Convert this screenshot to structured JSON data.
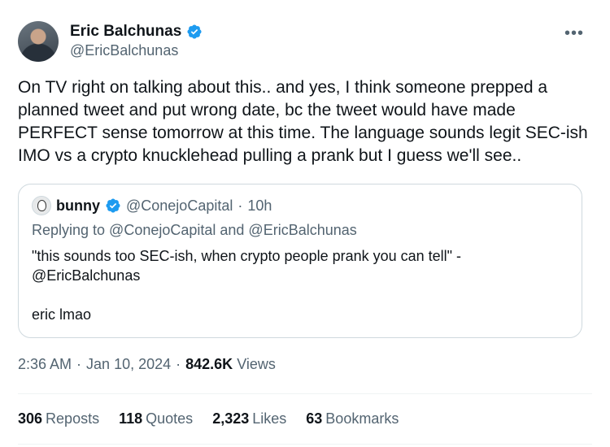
{
  "author": {
    "display_name": "Eric Balchunas",
    "handle": "@EricBalchunas"
  },
  "tweet_text": "On TV right on talking about this.. and yes, I think someone prepped a planned tweet and put wrong date, bc the tweet would have made PERFECT sense tomorrow at this time. The language sounds legit SEC-ish IMO vs a crypto knucklehead pulling a prank but I guess we'll see..",
  "quoted": {
    "display_name": "bunny",
    "handle": "@ConejoCapital",
    "separator": "·",
    "age": "10h",
    "replying_to": "Replying to @ConejoCapital and @EricBalchunas",
    "text": "\"this sounds too SEC-ish, when crypto people prank you can tell\" - @EricBalchunas",
    "text2": "eric lmao"
  },
  "meta": {
    "time": "2:36 AM",
    "sep1": "·",
    "date": "Jan 10, 2024",
    "sep2": "·",
    "views_count": "842.6K",
    "views_label": "Views"
  },
  "stats": [
    {
      "count": "306",
      "label": "Reposts"
    },
    {
      "count": "118",
      "label": "Quotes"
    },
    {
      "count": "2,323",
      "label": "Likes"
    },
    {
      "count": "63",
      "label": "Bookmarks"
    }
  ],
  "colors": {
    "verified": "#1d9bf0",
    "secondary_text": "#536471",
    "border": "#cfd9de"
  },
  "icons": {
    "verified": "verified-badge-icon",
    "more": "more-horizontal-icon"
  }
}
